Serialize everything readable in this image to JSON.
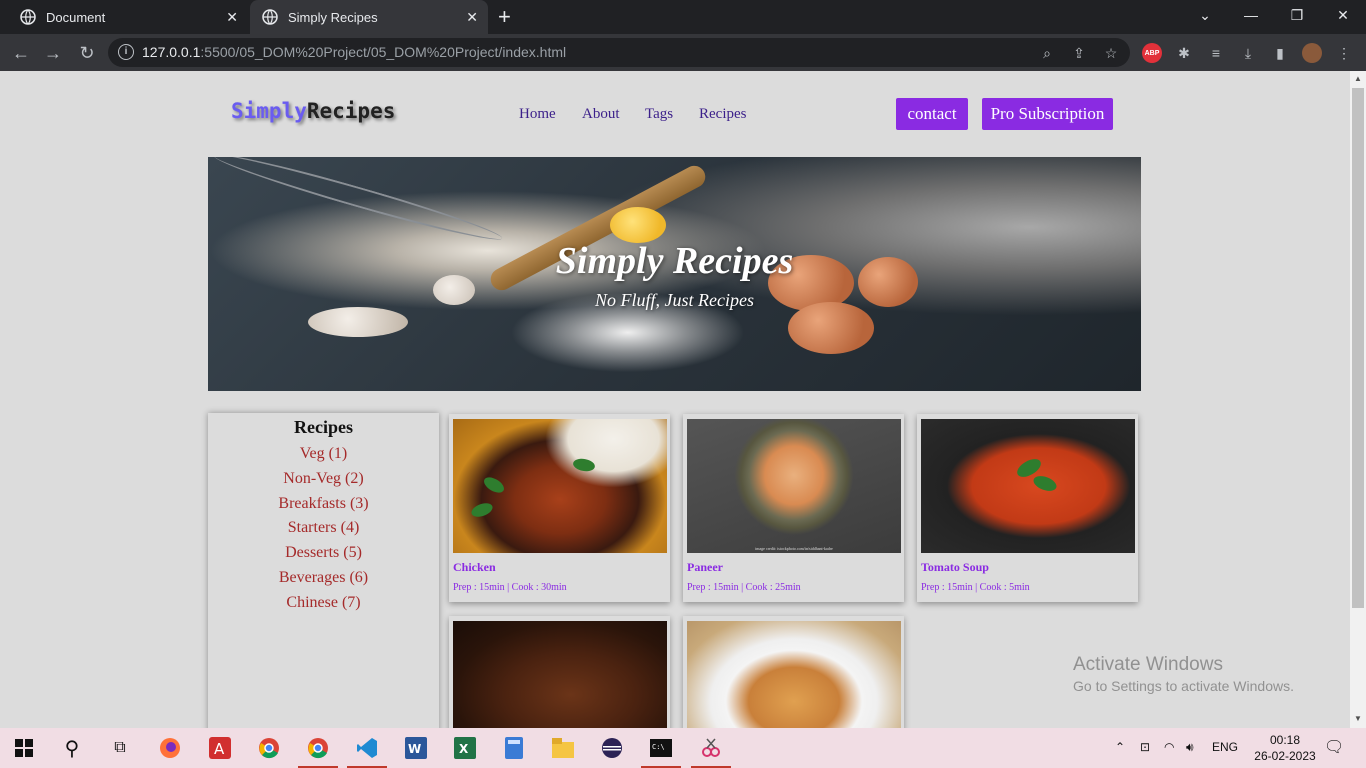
{
  "browser": {
    "tabs": [
      {
        "title": "Document",
        "active": false
      },
      {
        "title": "Simply Recipes",
        "active": true
      }
    ],
    "url_host": "127.0.0.1",
    "url_rest": ":5500/05_DOM%20Project/05_DOM%20Project/index.html",
    "ext_abp": "ABP"
  },
  "page": {
    "logo_part1": "Simply",
    "logo_part2": "Recipes",
    "nav": [
      "Home",
      "About",
      "Tags",
      "Recipes"
    ],
    "contact_label": "contact",
    "pro_label": "Pro Subscription",
    "hero_title": "Simply Recipes",
    "hero_subtitle": "No Fluff, Just Recipes",
    "sidebar_title": "Recipes",
    "categories": [
      "Veg (1)",
      "Non-Veg (2)",
      "Breakfasts (3)",
      "Starters (4)",
      "Desserts (5)",
      "Beverages (6)",
      "Chinese (7)"
    ],
    "cards": [
      {
        "title": "Chicken",
        "meta": "Prep : 15min | Cook : 30min"
      },
      {
        "title": "Paneer",
        "meta": "Prep : 15min | Cook : 25min"
      },
      {
        "title": "Tomato Soup",
        "meta": "Prep : 15min | Cook : 5min"
      },
      {
        "title": "",
        "meta": ""
      },
      {
        "title": "",
        "meta": ""
      }
    ],
    "paneer_credit": "image credit: istockphoto.com/in/siddhant-kadre"
  },
  "overlay": {
    "activate_title": "Activate Windows",
    "activate_sub": "Go to Settings to activate Windows."
  },
  "taskbar": {
    "lang": "ENG",
    "time": "00:18",
    "date": "26-02-2023"
  },
  "colors": {
    "accent_purple": "#8a2be2",
    "category_red": "#a52a2a",
    "nav_text": "#3b1f8a",
    "page_bg": "#dcdcdc"
  }
}
